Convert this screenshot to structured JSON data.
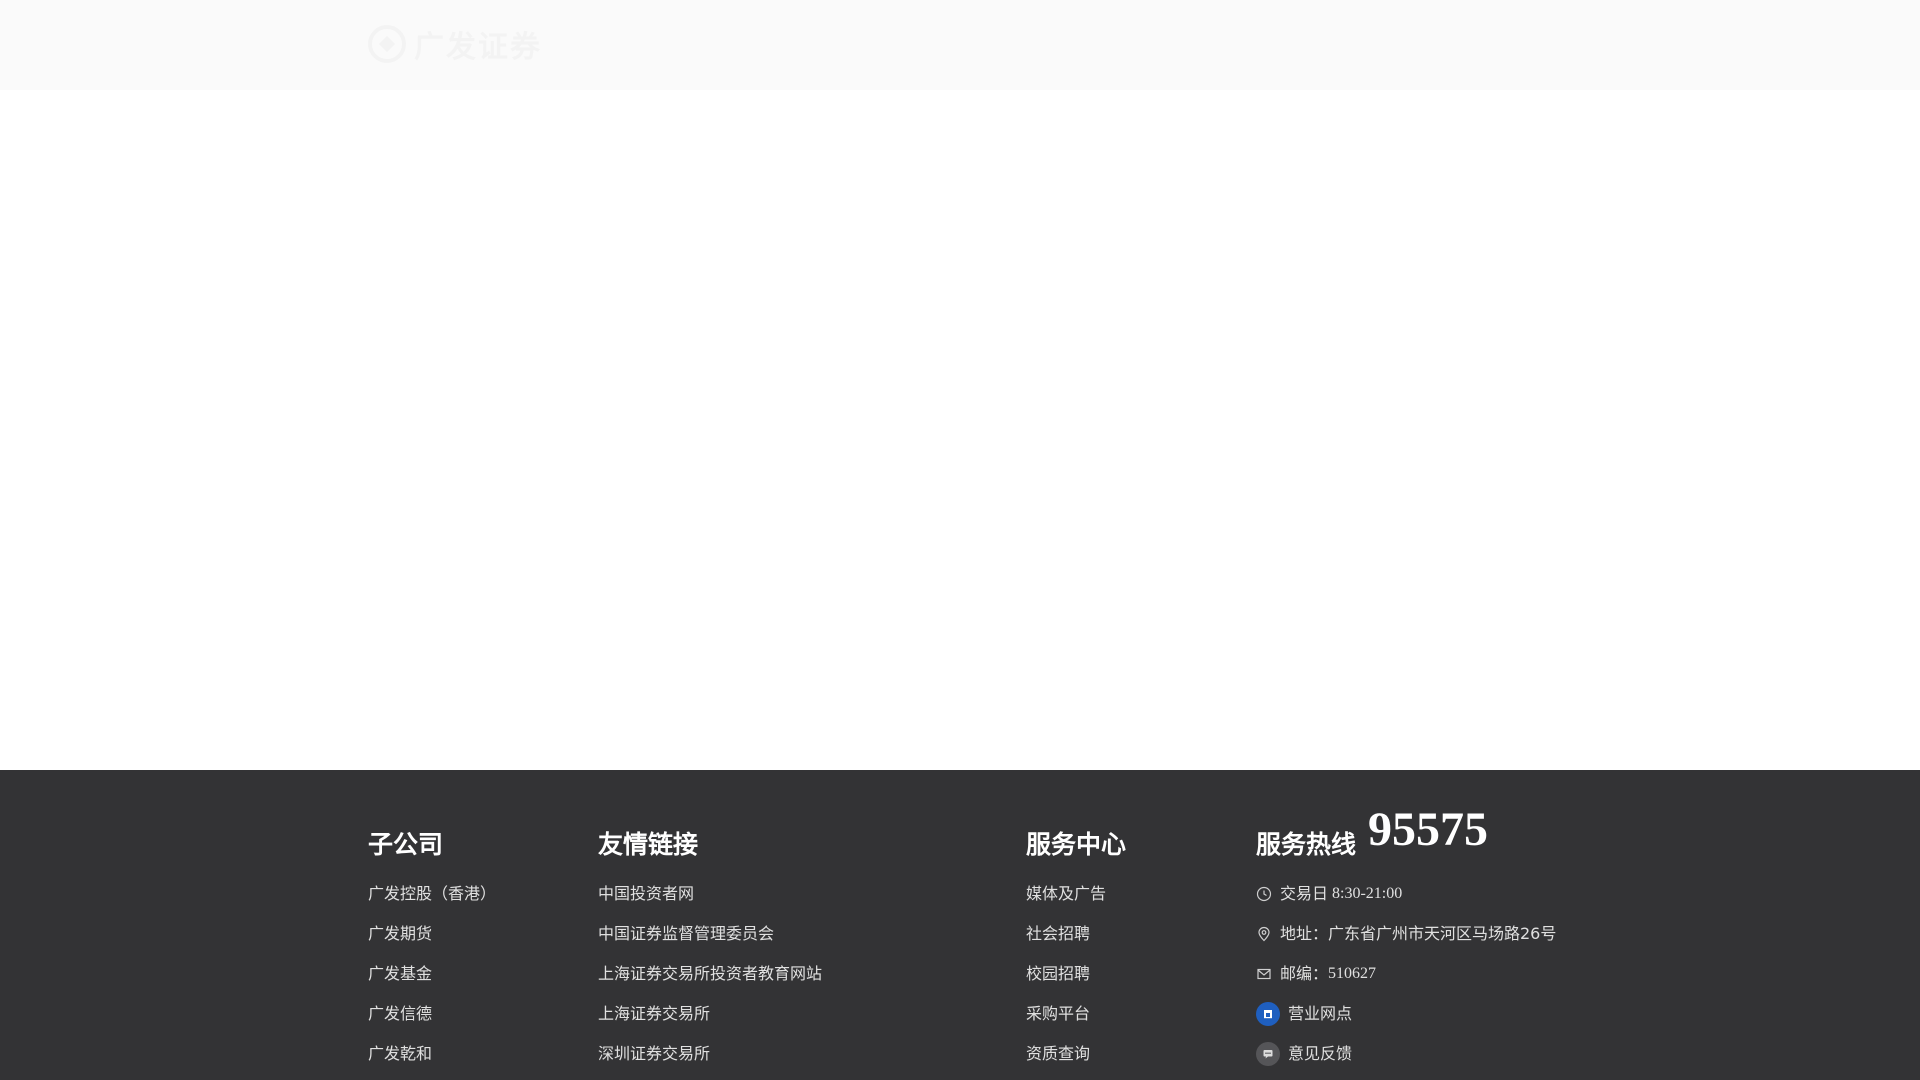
{
  "header": {
    "logo_text": "广发证券"
  },
  "footer": {
    "subsidiaries": {
      "title": "子公司",
      "items": [
        "广发控股（香港）",
        "广发期货",
        "广发基金",
        "广发信德",
        "广发乾和"
      ]
    },
    "friend_links": {
      "title": "友情链接",
      "items": [
        "中国投资者网",
        "中国证券监督管理委员会",
        "上海证券交易所投资者教育网站",
        "上海证券交易所",
        "深圳证券交易所"
      ]
    },
    "service_center": {
      "title": "服务中心",
      "items": [
        "媒体及广告",
        "社会招聘",
        "校园招聘",
        "采购平台",
        "资质查询"
      ]
    },
    "hotline": {
      "label": "服务热线",
      "number": "95575",
      "trading_day_label": "交易日",
      "trading_hours": "8:30-21:00",
      "address": "地址：广东省广州市天河区马场路26号",
      "postcode_label": "邮编：",
      "postcode": "510627",
      "branches_label": "营业网点",
      "feedback_label": "意见反馈"
    },
    "colors": {
      "background": "#333335",
      "branch_icon": "#1f5fbf",
      "feedback_icon": "#555558"
    },
    "icons": [
      "clock-icon",
      "location-pin-icon",
      "mail-icon",
      "branch-icon",
      "feedback-icon"
    ]
  }
}
